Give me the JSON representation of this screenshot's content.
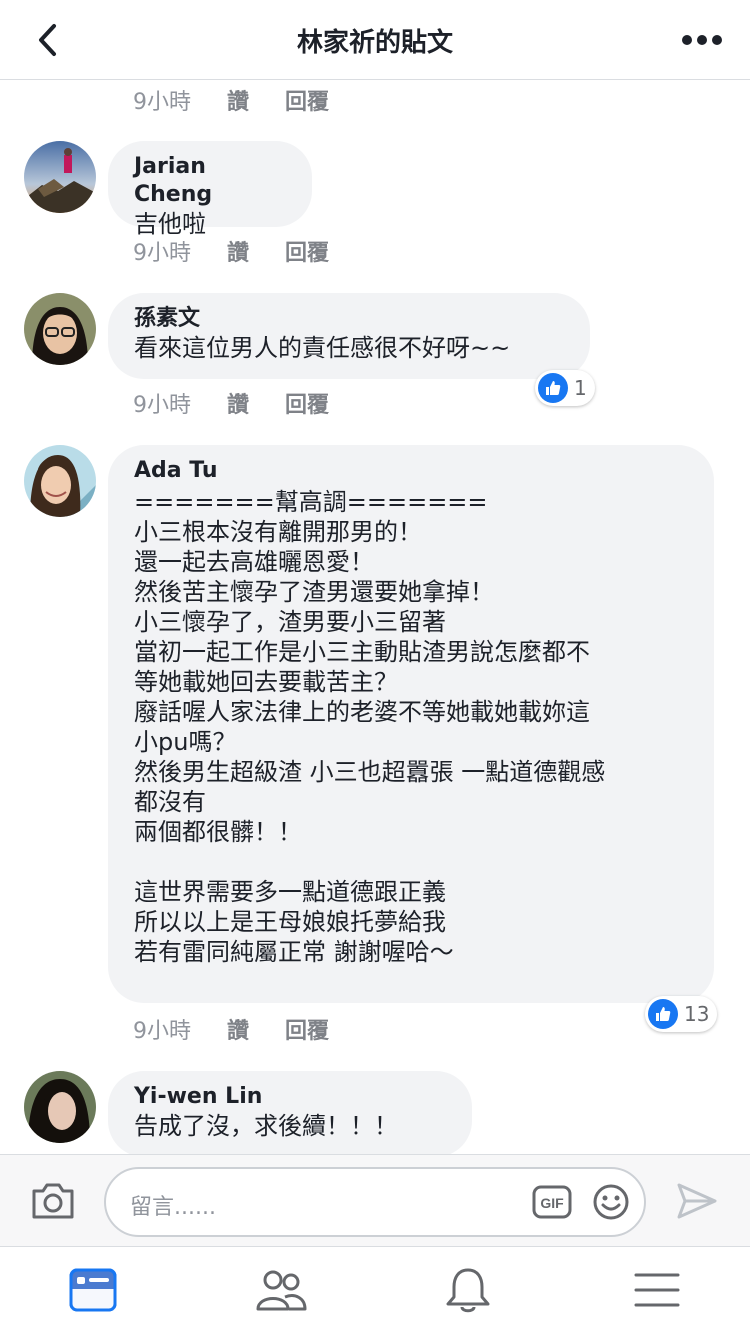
{
  "header": {
    "title": "林家祈的貼文"
  },
  "top_meta": {
    "time": "9小時",
    "like": "讚",
    "reply": "回覆"
  },
  "comments": [
    {
      "name": "Jarian Cheng",
      "text": "吉他啦",
      "time": "9小時",
      "like": "讚",
      "reply": "回覆"
    },
    {
      "name": "孫素文",
      "text": "看來這位男人的責任感很不好呀~~",
      "time": "9小時",
      "like": "讚",
      "reply": "回覆",
      "reaction_count": "1"
    },
    {
      "name": "Ada Tu",
      "text": "=======幫高調=======\n小三根本沒有離開那男的！\n還一起去高雄曬恩愛！\n然後苦主懷孕了渣男還要她拿掉！\n小三懷孕了，渣男要小三留著\n當初一起工作是小三主動貼渣男說怎麼都不\n等她載她回去要載苦主？\n廢話喔人家法律上的老婆不等她載她載妳這\n小pu嗎？\n然後男生超級渣 小三也超囂張 一點道德觀感\n都沒有\n兩個都很髒！！\n\n這世界需要多一點道德跟正義\n所以以上是王母娘娘托夢給我\n若有雷同純屬正常 謝謝喔哈～",
      "time": "9小時",
      "like": "讚",
      "reply": "回覆",
      "reaction_count": "13"
    },
    {
      "name": "Yi-wen Lin",
      "text": "告成了沒，求後續！！！"
    }
  ],
  "composer": {
    "placeholder": "留言......",
    "gif_label": "GIF"
  },
  "colors": {
    "accent": "#1877f2",
    "bubble": "#f2f3f5",
    "meta": "#90949c"
  },
  "icons": [
    "back-chevron-icon",
    "more-dots-icon",
    "camera-icon",
    "gif-icon",
    "emoji-icon",
    "send-icon",
    "news-feed-icon",
    "friends-icon",
    "notifications-bell-icon",
    "menu-icon",
    "thumbs-up-icon"
  ]
}
